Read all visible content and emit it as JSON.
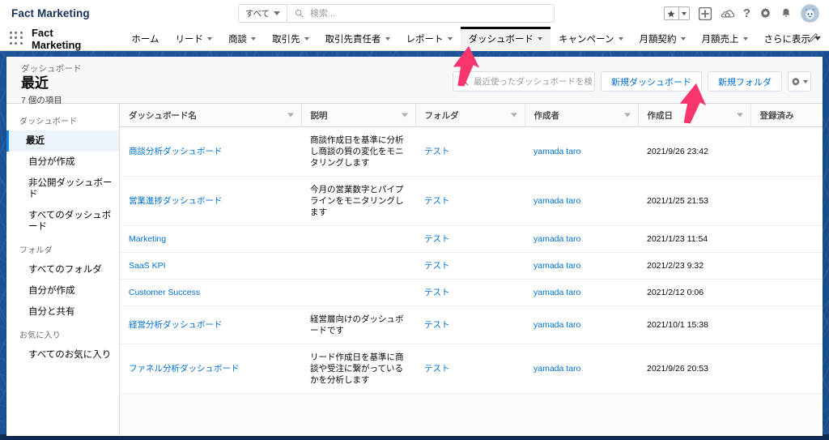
{
  "global_header": {
    "org_name": "Fact Marketing",
    "search_scope_label": "すべて",
    "search_placeholder": "検索...",
    "icons": {
      "favorites": "star-icon",
      "favorites_caret": "chevron-down-icon",
      "add": "plus-icon",
      "setup_assistant": "cloud-home-icon",
      "help": "question-mark-icon",
      "setup": "gear-icon",
      "notifications": "bell-icon",
      "avatar": "user-avatar"
    }
  },
  "app_nav": {
    "launcher": "app-launcher-waffle-icon",
    "app_name": "Fact Marketing",
    "edit_icon": "pencil-icon",
    "items": [
      {
        "label": "ホーム",
        "has_caret": false,
        "active": false
      },
      {
        "label": "リード",
        "has_caret": true,
        "active": false
      },
      {
        "label": "商談",
        "has_caret": true,
        "active": false
      },
      {
        "label": "取引先",
        "has_caret": true,
        "active": false
      },
      {
        "label": "取引先責任者",
        "has_caret": true,
        "active": false
      },
      {
        "label": "レポート",
        "has_caret": true,
        "active": false
      },
      {
        "label": "ダッシュボード",
        "has_caret": true,
        "active": true
      },
      {
        "label": "キャンペーン",
        "has_caret": true,
        "active": false
      },
      {
        "label": "月額契約",
        "has_caret": true,
        "active": false
      },
      {
        "label": "月額売上",
        "has_caret": true,
        "active": false
      },
      {
        "label": "さらに表示",
        "has_caret": true,
        "active": false
      }
    ]
  },
  "page_header": {
    "eyebrow": "ダッシュボード",
    "title": "最近",
    "item_count": "7 個の項目",
    "search_placeholder": "最近使ったダッシュボードを検索..",
    "new_dashboard_label": "新規ダッシュボード",
    "new_folder_label": "新規フォルダ",
    "settings_icon": "gear-icon"
  },
  "sidebar": {
    "groups": [
      {
        "label": "ダッシュボード",
        "items": [
          {
            "label": "最近",
            "selected": true
          },
          {
            "label": "自分が作成",
            "selected": false
          },
          {
            "label": "非公開ダッシュボード",
            "selected": false
          },
          {
            "label": "すべてのダッシュボード",
            "selected": false
          }
        ]
      },
      {
        "label": "フォルダ",
        "items": [
          {
            "label": "すべてのフォルダ",
            "selected": false
          },
          {
            "label": "自分が作成",
            "selected": false
          },
          {
            "label": "自分と共有",
            "selected": false
          }
        ]
      },
      {
        "label": "お気に入り",
        "items": [
          {
            "label": "すべてのお気に入り",
            "selected": false
          }
        ]
      }
    ]
  },
  "table": {
    "columns": [
      {
        "label": "ダッシュボード名",
        "sortable": true
      },
      {
        "label": "説明",
        "sortable": true
      },
      {
        "label": "フォルダ",
        "sortable": true
      },
      {
        "label": "作成者",
        "sortable": true
      },
      {
        "label": "作成日",
        "sortable": true
      },
      {
        "label": "登録済み",
        "sortable": false
      }
    ],
    "rows": [
      {
        "name": "商談分析ダッシュボード",
        "description": "商談作成日を基準に分析し商談の質の変化をモニタリングします",
        "folder": "テスト",
        "owner": "yamada taro",
        "created": "2021/9/26 23:42",
        "subscribed": ""
      },
      {
        "name": "営業進捗ダッシュボード",
        "description": "今月の営業数字とパイプラインをモニタリングします",
        "folder": "テスト",
        "owner": "yamada taro",
        "created": "2021/1/25 21:53",
        "subscribed": ""
      },
      {
        "name": "Marketing",
        "description": "",
        "folder": "テスト",
        "owner": "yamada taro",
        "created": "2021/1/23 11:54",
        "subscribed": ""
      },
      {
        "name": "SaaS KPI",
        "description": "",
        "folder": "テスト",
        "owner": "yamada taro",
        "created": "2021/2/23 9:32",
        "subscribed": ""
      },
      {
        "name": "Customer Success",
        "description": "",
        "folder": "テスト",
        "owner": "yamada taro",
        "created": "2021/2/12 0:06",
        "subscribed": ""
      },
      {
        "name": "経営分析ダッシュボード",
        "description": "経営層向けのダッシュボードです",
        "folder": "テスト",
        "owner": "yamada taro",
        "created": "2021/10/1 15:38",
        "subscribed": ""
      },
      {
        "name": "ファネル分析ダッシュボード",
        "description": "リード作成日を基準に商談や受注に繋がっているかを分析します",
        "folder": "テスト",
        "owner": "yamada taro",
        "created": "2021/9/26 20:53",
        "subscribed": ""
      }
    ]
  },
  "annotations": [
    {
      "name": "arrow-to-dashboard-tab",
      "color": "#f7366d"
    },
    {
      "name": "arrow-to-new-dashboard-button",
      "color": "#f7366d"
    }
  ],
  "colors": {
    "link": "#0070d2",
    "backdrop_blue": "#1b5297",
    "selected_nav": "#ecf3fa",
    "selected_nav_border": "#1589ee",
    "annotation_pink": "#f7366d"
  }
}
